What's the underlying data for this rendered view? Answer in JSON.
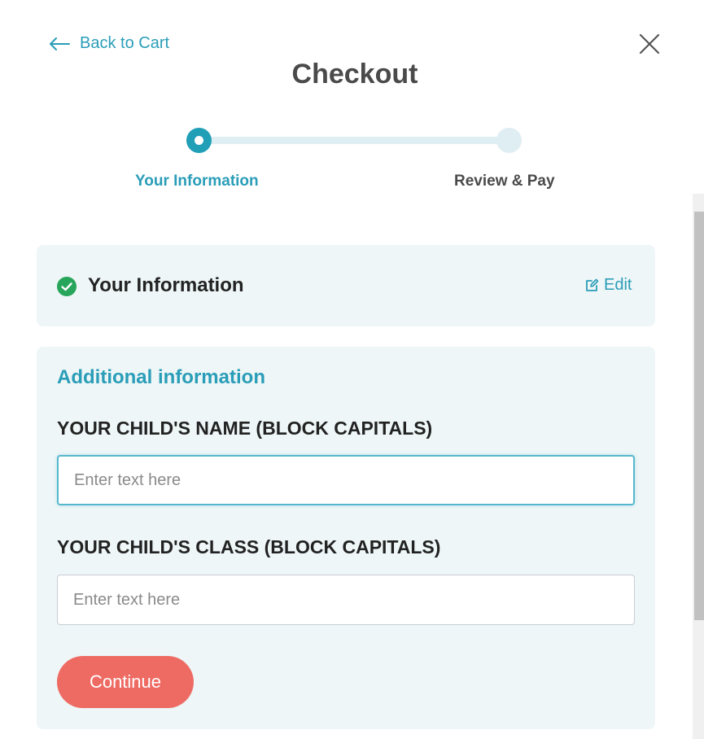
{
  "header": {
    "back_label": "Back to Cart",
    "title": "Checkout"
  },
  "stepper": {
    "steps": [
      {
        "label": "Your Information",
        "state": "active"
      },
      {
        "label": "Review & Pay",
        "state": "pending"
      }
    ],
    "active_color": "#219fb7",
    "track_color": "#dfeef2"
  },
  "info_card": {
    "title": "Your Information",
    "status_icon": "check-circle-icon",
    "edit_label": "Edit",
    "edit_icon": "edit-icon"
  },
  "additional": {
    "heading": "Additional information",
    "fields": [
      {
        "label": "YOUR CHILD'S NAME (BLOCK CAPITALS)",
        "placeholder": "Enter text here",
        "value": ""
      },
      {
        "label": "YOUR CHILD'S CLASS (BLOCK CAPITALS)",
        "placeholder": "Enter text here",
        "value": ""
      }
    ],
    "continue_label": "Continue"
  },
  "colors": {
    "accent": "#2a9db8",
    "success": "#27a55a",
    "primary_button": "#ee6b64",
    "card_background": "#eef6f7"
  }
}
